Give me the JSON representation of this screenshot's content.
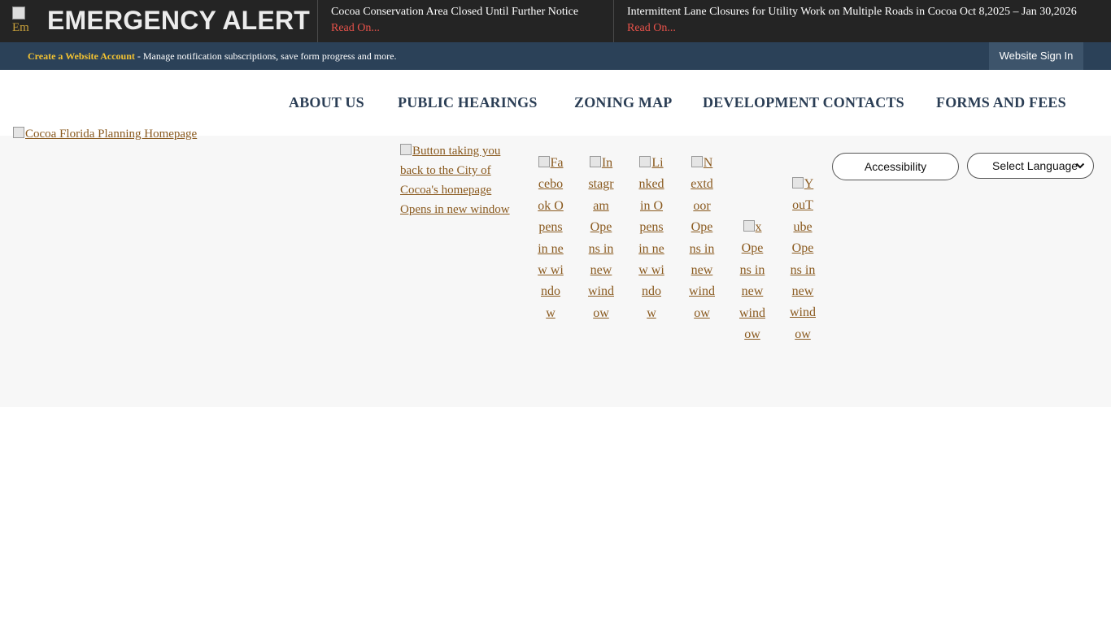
{
  "alert": {
    "icon_alt": "Em",
    "title": "EMERGENCY ALERT",
    "items": [
      {
        "headline": "Cocoa Conservation Area Closed Until Further Notice",
        "read_on": "Read On..."
      },
      {
        "headline": "Intermittent Lane Closures for Utility Work on Multiple Roads in Cocoa Oct 8,2025 – Jan 30,2026",
        "read_on": "Read On..."
      }
    ]
  },
  "account": {
    "link_text": "Create a Website Account",
    "description": " - Manage notification subscriptions, save form progress and more.",
    "signin_label": "Website Sign In"
  },
  "nav": {
    "items": [
      "ABOUT US",
      "PUBLIC HEARINGS",
      "ZONING MAP",
      "DEVELOPMENT CONTACTS",
      "FORMS AND FEES"
    ]
  },
  "header": {
    "logo_alt": "Cocoa Florida Planning Homepage",
    "home_button_alt": "Button taking you back to the City of Cocoa's homepage Opens in new window",
    "social": [
      {
        "name": "facebook-icon",
        "alt": "Facebook Opens in new window"
      },
      {
        "name": "instagram-icon",
        "alt": "Instagram Opens in new window"
      },
      {
        "name": "linkedin-icon",
        "alt": "Linkedin Opens in new window"
      },
      {
        "name": "nextdoor-icon",
        "alt": "Nextdoor Opens in new window"
      },
      {
        "name": "x-icon",
        "alt": "x Opens in new window"
      },
      {
        "name": "youtube-icon",
        "alt": "YouTube Opens in new window"
      }
    ],
    "accessibility_label": "Accessibility",
    "language_label": "Select Language"
  },
  "colors": {
    "alert_bg": "#242424",
    "account_bar_bg": "#2b4158",
    "account_link": "#f2c232",
    "read_on": "#e8524a",
    "nav_text": "#2b3e55",
    "link": "#8a5a1f",
    "band_bg": "#f7f7f7"
  }
}
